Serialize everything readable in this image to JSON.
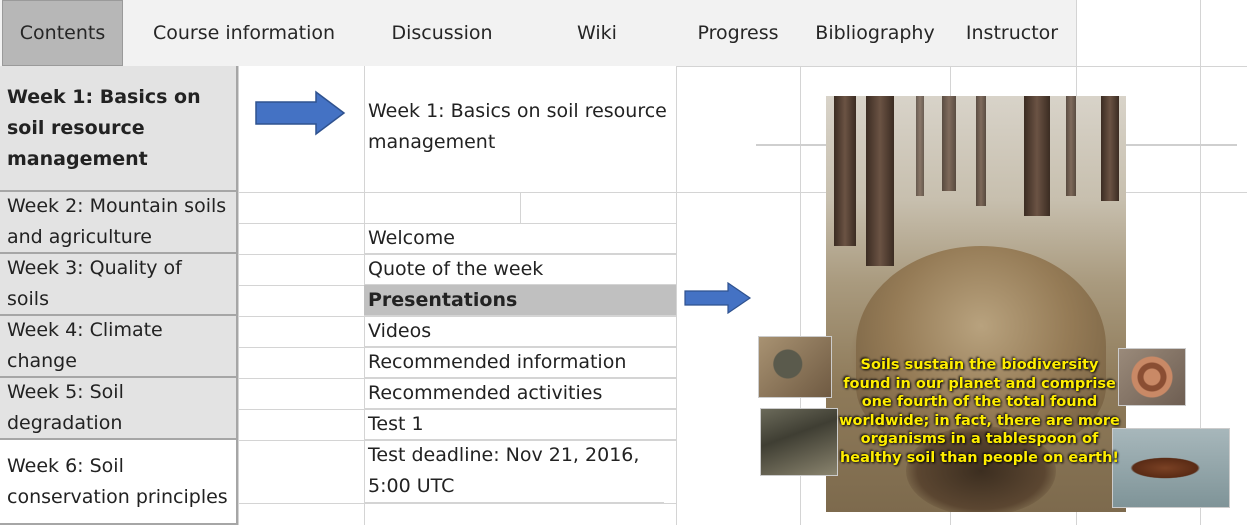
{
  "tabs": [
    {
      "label": "Contents",
      "active": true
    },
    {
      "label": "Course information",
      "active": false
    },
    {
      "label": "Discussion",
      "active": false
    },
    {
      "label": "Wiki",
      "active": false
    },
    {
      "label": "Progress",
      "active": false
    },
    {
      "label": "Bibliography",
      "active": false
    },
    {
      "label": "Instructor",
      "active": false
    }
  ],
  "weeks": [
    "Week 1: Basics on soil resource management",
    "Week 2: Mountain soils and agriculture",
    "Week 3: Quality of soils",
    "Week 4: Climate change",
    "Week 5: Soil degradation",
    "Week 6: Soil conservation principles"
  ],
  "section_title": "Week 1: Basics on soil resource management",
  "items": [
    "Welcome",
    "Quote of the week",
    "Presentations",
    "Videos",
    "Recommended information",
    "Recommended activities",
    "Test 1",
    "Test deadline: Nov 21, 2016, 5:00 UTC"
  ],
  "caption": "Soils sustain the biodiversity found in our planet and comprise one fourth of the total found worldwide; in fact, there are more organisms in a tablespoon of healthy soil than people on earth!",
  "colors": {
    "arrow": "#4472c4",
    "caption": "#ffee00",
    "active_tab": "#b7b7b7",
    "highlight_row": "#c0c0c0"
  },
  "icons": [
    "arrow-right-icon"
  ]
}
